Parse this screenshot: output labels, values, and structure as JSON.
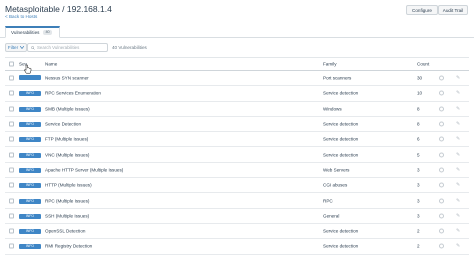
{
  "header": {
    "title": "Metasploitable / 192.168.1.4",
    "back_link": "< Back to Hosts",
    "configure_label": "Configure",
    "audit_trail_label": "Audit Trail"
  },
  "tabs": [
    {
      "label": "Vulnerabilities",
      "count": "40"
    }
  ],
  "toolbar": {
    "filter_label": "Filter",
    "search_placeholder": "Search Vulnerabilities",
    "result_count": "40 Vulnerabilities"
  },
  "table": {
    "columns": {
      "sev": "Sev",
      "name": "Name",
      "family": "Family",
      "count": "Count"
    },
    "rows": [
      {
        "sev": "",
        "name": "Nessus SYN scanner",
        "family": "Port scanners",
        "count": "30"
      },
      {
        "sev": "INFO",
        "name": "RPC Services Enumeration",
        "family": "Service detection",
        "count": "10"
      },
      {
        "sev": "INFO",
        "name": "SMB (Multiple Issues)",
        "family": "Windows",
        "count": "8"
      },
      {
        "sev": "INFO",
        "name": "Service Detection",
        "family": "Service detection",
        "count": "8"
      },
      {
        "sev": "INFO",
        "name": "FTP (Multiple Issues)",
        "family": "Service detection",
        "count": "6"
      },
      {
        "sev": "INFO",
        "name": "VNC (Multiple Issues)",
        "family": "Service detection",
        "count": "5"
      },
      {
        "sev": "INFO",
        "name": "Apache HTTP Server (Multiple Issues)",
        "family": "Web Servers",
        "count": "3"
      },
      {
        "sev": "INFO",
        "name": "HTTP (Multiple Issues)",
        "family": "CGI abuses",
        "count": "3"
      },
      {
        "sev": "INFO",
        "name": "RPC (Multiple Issues)",
        "family": "RPC",
        "count": "3"
      },
      {
        "sev": "INFO",
        "name": "SSH (Multiple Issues)",
        "family": "General",
        "count": "3"
      },
      {
        "sev": "INFO",
        "name": "OpenSSL Detection",
        "family": "Service detection",
        "count": "2"
      },
      {
        "sev": "INFO",
        "name": "RMI Registry Detection",
        "family": "Service detection",
        "count": "2"
      }
    ]
  },
  "colors": {
    "accent": "#3d7fb8",
    "info_badge": "#3f86c6"
  }
}
